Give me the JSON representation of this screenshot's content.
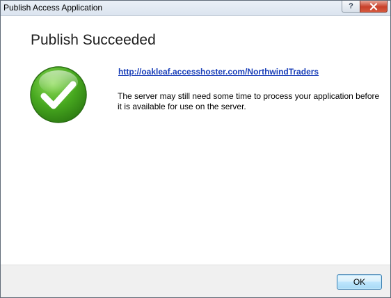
{
  "window": {
    "title": "Publish Access Application",
    "help_button_label": "?",
    "close_button_icon": "close-icon"
  },
  "content": {
    "heading": "Publish Succeeded",
    "status_icon": "checkmark-circle-icon",
    "link": "http://oakleaf.accesshoster.com/NorthwindTraders",
    "message": "The server may still need some time to process your application before it is available for use on the server."
  },
  "footer": {
    "ok_label": "OK"
  },
  "colors": {
    "link": "#1a3fb8",
    "success_green": "#3c9a1c",
    "close_red": "#c8402a"
  }
}
